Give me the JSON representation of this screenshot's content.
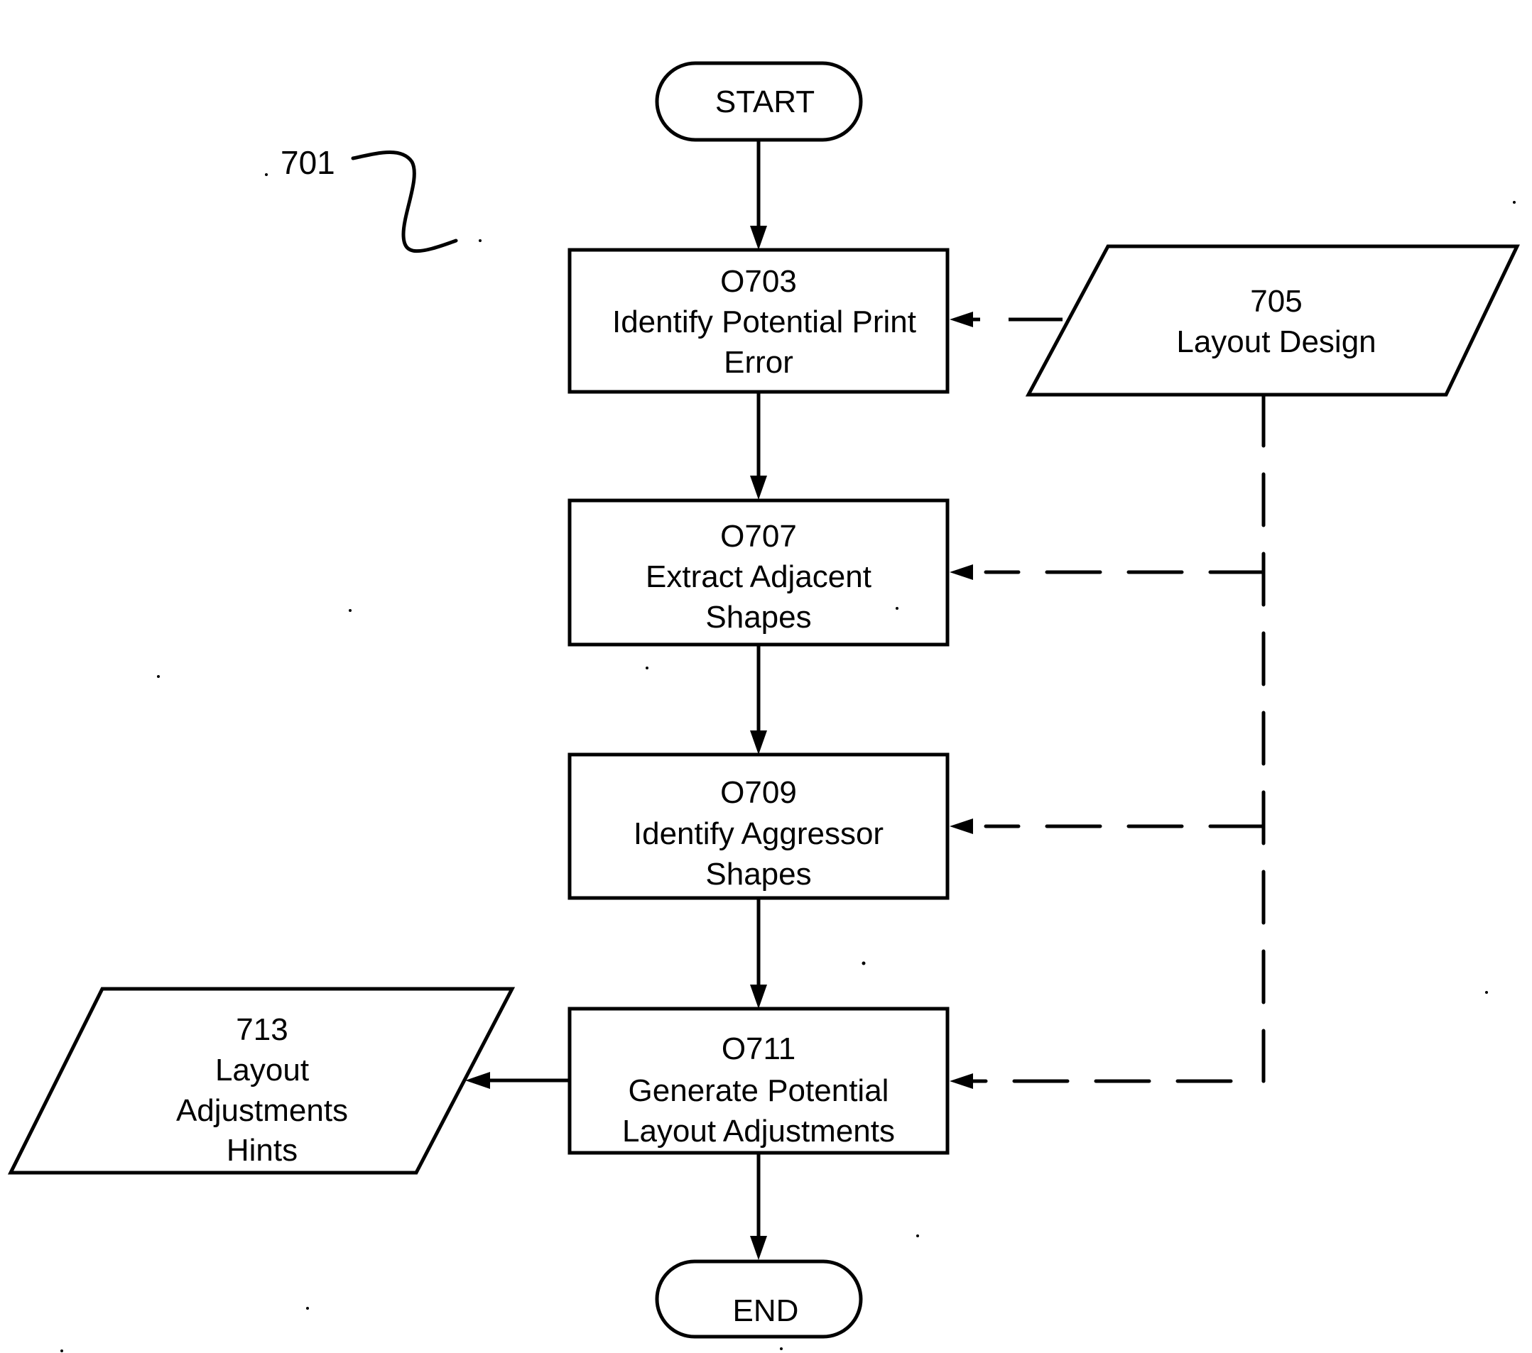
{
  "figure": {
    "reference_label": "701",
    "nodes": {
      "start": {
        "label": "START"
      },
      "op_703": {
        "id": "O703",
        "lines": [
          "O703",
          "Identify Potential Print",
          "Error"
        ]
      },
      "data_705": {
        "id": "705",
        "lines": [
          "705",
          "Layout Design"
        ]
      },
      "op_707": {
        "id": "O707",
        "lines": [
          "O707",
          "Extract Adjacent",
          "Shapes"
        ]
      },
      "op_709": {
        "id": "O709",
        "lines": [
          "O709",
          "Identify Aggressor",
          "Shapes"
        ]
      },
      "op_711": {
        "id": "O711",
        "lines": [
          "O711",
          "Generate Potential",
          "Layout Adjustments"
        ]
      },
      "data_713": {
        "id": "713",
        "lines": [
          "713",
          "Layout",
          "Adjustments",
          "Hints"
        ]
      },
      "end": {
        "label": "END"
      }
    },
    "edges": [
      {
        "from": "START",
        "to": "O703",
        "style": "solid"
      },
      {
        "from": "705",
        "to": "O703",
        "style": "solid"
      },
      {
        "from": "O703",
        "to": "O707",
        "style": "solid"
      },
      {
        "from": "705",
        "to": "O707",
        "style": "dashed"
      },
      {
        "from": "O707",
        "to": "O709",
        "style": "solid"
      },
      {
        "from": "705",
        "to": "O709",
        "style": "dashed"
      },
      {
        "from": "O709",
        "to": "O711",
        "style": "solid"
      },
      {
        "from": "705",
        "to": "O711",
        "style": "dashed"
      },
      {
        "from": "O711",
        "to": "713",
        "style": "solid"
      },
      {
        "from": "O711",
        "to": "END",
        "style": "solid"
      }
    ]
  }
}
